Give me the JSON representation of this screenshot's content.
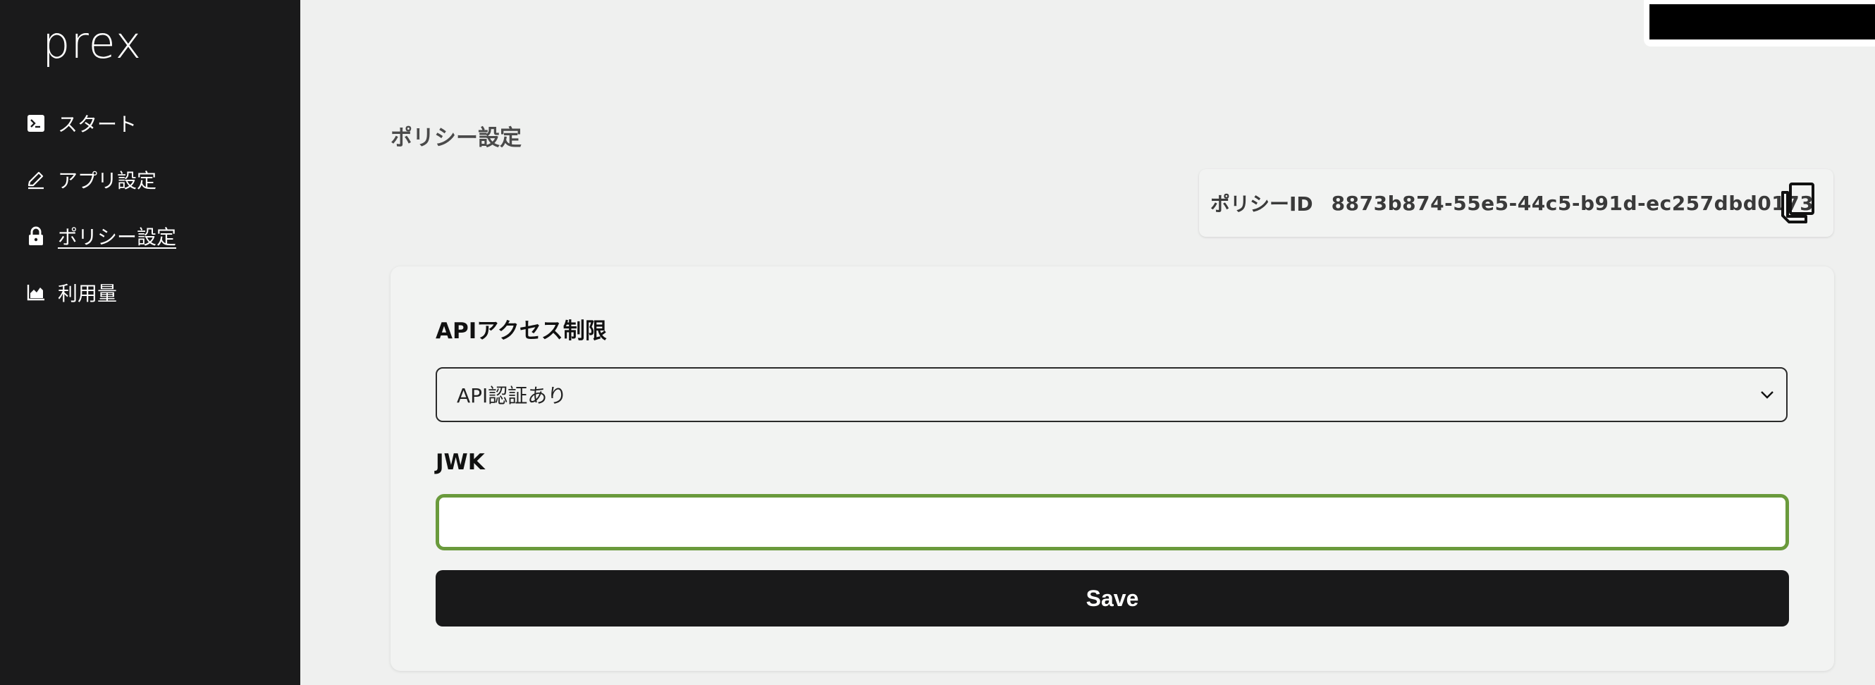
{
  "app": {
    "logo": "prex"
  },
  "sidebar": {
    "items": [
      {
        "label": "スタート",
        "icon": "terminal-icon",
        "active": false
      },
      {
        "label": "アプリ設定",
        "icon": "pencil-icon",
        "active": false
      },
      {
        "label": "ポリシー設定",
        "icon": "lock-icon",
        "active": true
      },
      {
        "label": "利用量",
        "icon": "area-chart-icon",
        "active": false
      }
    ]
  },
  "page": {
    "title": "ポリシー設定"
  },
  "policy": {
    "id_label": "ポリシーID",
    "id_value": "8873b874-55e5-44c5-b91d-ec257dbd0173"
  },
  "form": {
    "api_access_label": "APIアクセス制限",
    "api_access_selected": "API認証あり",
    "jwk_label": "JWK",
    "jwk_value": "",
    "jwk_placeholder": "",
    "save_label": "Save"
  },
  "colors": {
    "sidebar_bg": "#1a1a1b",
    "page_bg": "#eff0ef",
    "focus_border": "#6a9a3c",
    "button_bg": "#19191a"
  }
}
